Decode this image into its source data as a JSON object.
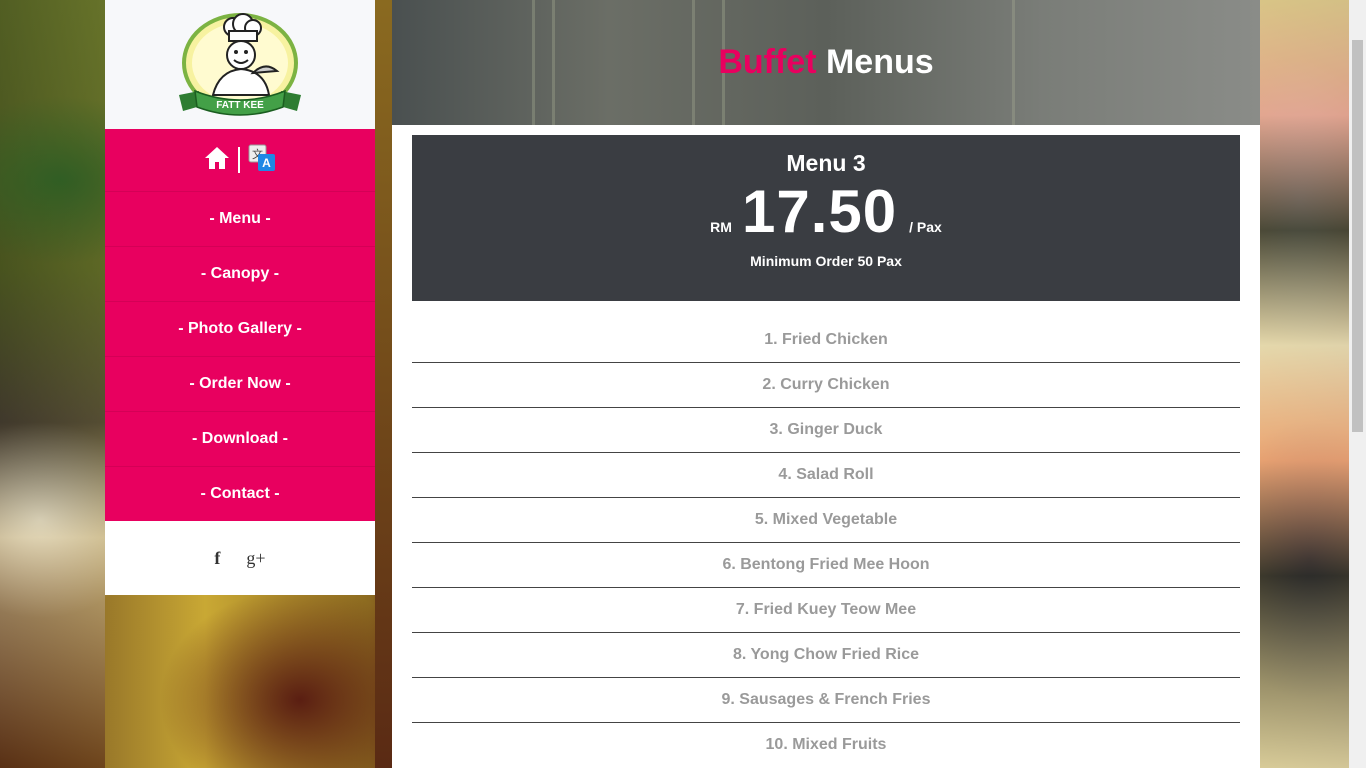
{
  "brand": {
    "logo_text": "FATT KEE"
  },
  "nav": {
    "home_icon": "home-icon",
    "translate_icon": "translate-icon",
    "items": [
      {
        "label": "- Menu -"
      },
      {
        "label": "- Canopy -"
      },
      {
        "label": "- Photo Gallery -"
      },
      {
        "label": "- Order Now -"
      },
      {
        "label": "- Download -"
      },
      {
        "label": "- Contact -"
      }
    ]
  },
  "social": {
    "facebook": "f",
    "google_plus": "g+"
  },
  "hero": {
    "title_accent": "Buffet",
    "title_rest": "Menus"
  },
  "menu": {
    "name": "Menu 3",
    "currency": "RM",
    "price": "17.50",
    "unit": "/ Pax",
    "minimum": "Minimum Order 50 Pax",
    "items": [
      "1. Fried Chicken",
      "2. Curry Chicken",
      "3. Ginger Duck",
      "4. Salad Roll",
      "5. Mixed Vegetable",
      "6. Bentong Fried Mee Hoon",
      "7. Fried Kuey Teow Mee",
      "8. Yong Chow Fried Rice",
      "9. Sausages & French Fries",
      "10. Mixed Fruits"
    ]
  },
  "colors": {
    "accent": "#e8005f",
    "price_box": "#3a3d42"
  }
}
